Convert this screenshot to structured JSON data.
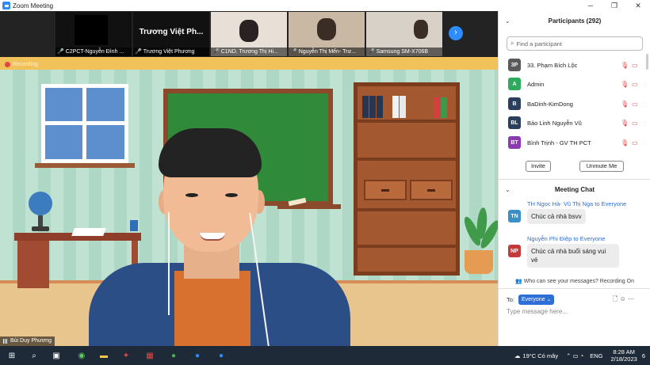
{
  "window": {
    "title": "Zoom Meeting",
    "minimize": "─",
    "maximize": "❐",
    "close": "✕"
  },
  "thumbnails": [
    {
      "label": "C2PCT-Nguyễn Đình ...",
      "big_name": ""
    },
    {
      "label": "Trương Việt Phương",
      "big_name": "Trương Việt Ph..."
    },
    {
      "label": "C1ND. Trương Thị Hi...",
      "big_name": ""
    },
    {
      "label": "Nguyễn Thị Mến- Trư...",
      "big_name": ""
    },
    {
      "label": "Samsung SM-X706B",
      "big_name": ""
    }
  ],
  "main": {
    "recording_label": "Recording",
    "speaker_name": "Bùi Duy Phương"
  },
  "participants": {
    "header": "Participants (292)",
    "search_placeholder": "Find a participant",
    "items": [
      {
        "initials": "3P",
        "name": "33. Phạm Bích Lộc",
        "color": "#5a5a5a"
      },
      {
        "initials": "A",
        "name": "Admin",
        "color": "#2eaa5c"
      },
      {
        "initials": "B",
        "name": "BaDinh-KimDong",
        "color": "#2a3e5e"
      },
      {
        "initials": "BL",
        "name": "Bảo Linh Nguyễn Vũ",
        "color": "#2a3e5e"
      },
      {
        "initials": "BT",
        "name": "Bình Trịnh - GV TH PCT",
        "color": "#8b3ab0"
      }
    ],
    "invite_label": "Invite",
    "unmute_label": "Unmute Me"
  },
  "chat": {
    "header": "Meeting Chat",
    "messages": [
      {
        "initials": "TN",
        "from": "TH Ngọc Hà- Vũ Thị Nga to Everyone",
        "text": "Chúc cả nhà bsvv",
        "color": "#3a8fc7"
      },
      {
        "initials": "NP",
        "from": "Nguyễn Phi Điệp to Everyone",
        "text_line1": "Chúc cả nhà buổi sáng vui",
        "text_line2": "vẻ",
        "color": "#c43a3a"
      }
    ],
    "who_can_see": "Who can see your messages? Recording On",
    "to_label": "To:",
    "to_value": "Everyone",
    "input_placeholder": "Type message here..."
  },
  "taskbar": {
    "weather": "19°C Có mây",
    "language": "ENG",
    "time": "8:28 AM",
    "date": "2/18/2023",
    "notifications": "6"
  },
  "colors": {
    "accent": "#2d8cff",
    "muted_red": "#e03b3b",
    "chat_name_blue": "#2d6fd6"
  }
}
